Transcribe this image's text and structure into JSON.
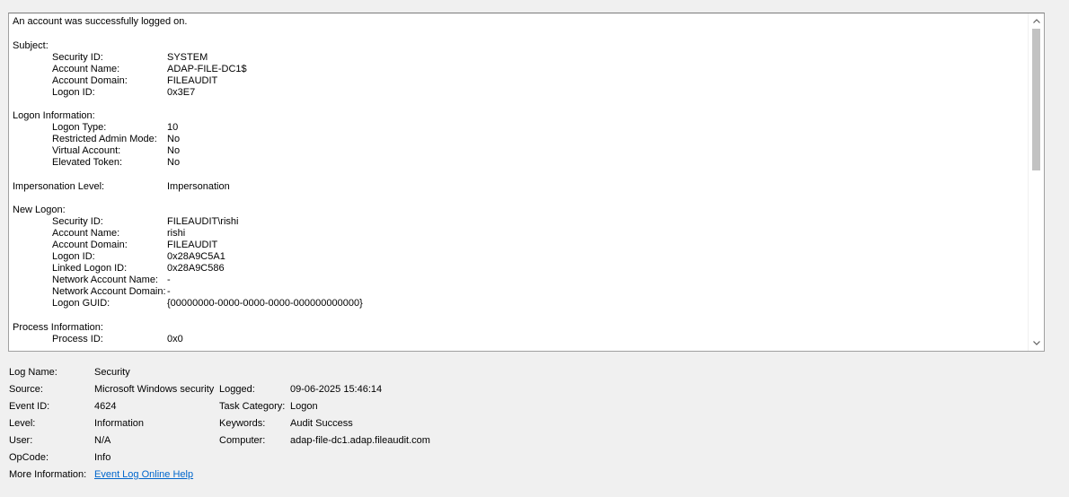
{
  "description": {
    "header": "An account was successfully logged on.",
    "sections": [
      {
        "title": "Subject:",
        "rows": [
          {
            "key": "Security ID:",
            "value": "SYSTEM"
          },
          {
            "key": "Account Name:",
            "value": "ADAP-FILE-DC1$"
          },
          {
            "key": "Account Domain:",
            "value": "FILEAUDIT"
          },
          {
            "key": "Logon ID:",
            "value": "0x3E7"
          }
        ]
      },
      {
        "title": "Logon Information:",
        "rows": [
          {
            "key": "Logon Type:",
            "value": "10"
          },
          {
            "key": "Restricted Admin Mode:",
            "value": "No"
          },
          {
            "key": "Virtual Account:",
            "value": "No"
          },
          {
            "key": "Elevated Token:",
            "value": "No"
          }
        ]
      },
      {
        "title": "Impersonation Level:",
        "title_value": "Impersonation",
        "rows": []
      },
      {
        "title": "New Logon:",
        "rows": [
          {
            "key": "Security ID:",
            "value": "FILEAUDIT\\rishi"
          },
          {
            "key": "Account Name:",
            "value": "rishi"
          },
          {
            "key": "Account Domain:",
            "value": "FILEAUDIT"
          },
          {
            "key": "Logon ID:",
            "value": "0x28A9C5A1"
          },
          {
            "key": "Linked Logon ID:",
            "value": "0x28A9C586"
          },
          {
            "key": "Network Account Name:",
            "value": "-"
          },
          {
            "key": "Network Account Domain:",
            "value": "-"
          },
          {
            "key": "Logon GUID:",
            "value": "{00000000-0000-0000-0000-000000000000}"
          }
        ]
      },
      {
        "title": "Process Information:",
        "rows": [
          {
            "key": "Process ID:",
            "value": "0x0"
          }
        ]
      }
    ]
  },
  "scrollbar": {
    "up_icon": "chevron-up-icon",
    "down_icon": "chevron-down-icon"
  },
  "properties": {
    "log_name_label": "Log Name:",
    "log_name": "Security",
    "source_label": "Source:",
    "source": "Microsoft Windows security",
    "logged_label": "Logged:",
    "logged": "09-06-2025 15:46:14",
    "event_id_label": "Event ID:",
    "event_id": "4624",
    "task_category_label": "Task Category:",
    "task_category": "Logon",
    "level_label": "Level:",
    "level": "Information",
    "keywords_label": "Keywords:",
    "keywords": "Audit Success",
    "user_label": "User:",
    "user": "N/A",
    "computer_label": "Computer:",
    "computer": "adap-file-dc1.adap.fileaudit.com",
    "opcode_label": "OpCode:",
    "opcode": "Info",
    "more_info_label": "More Information:",
    "more_info_link": "Event Log Online Help"
  }
}
